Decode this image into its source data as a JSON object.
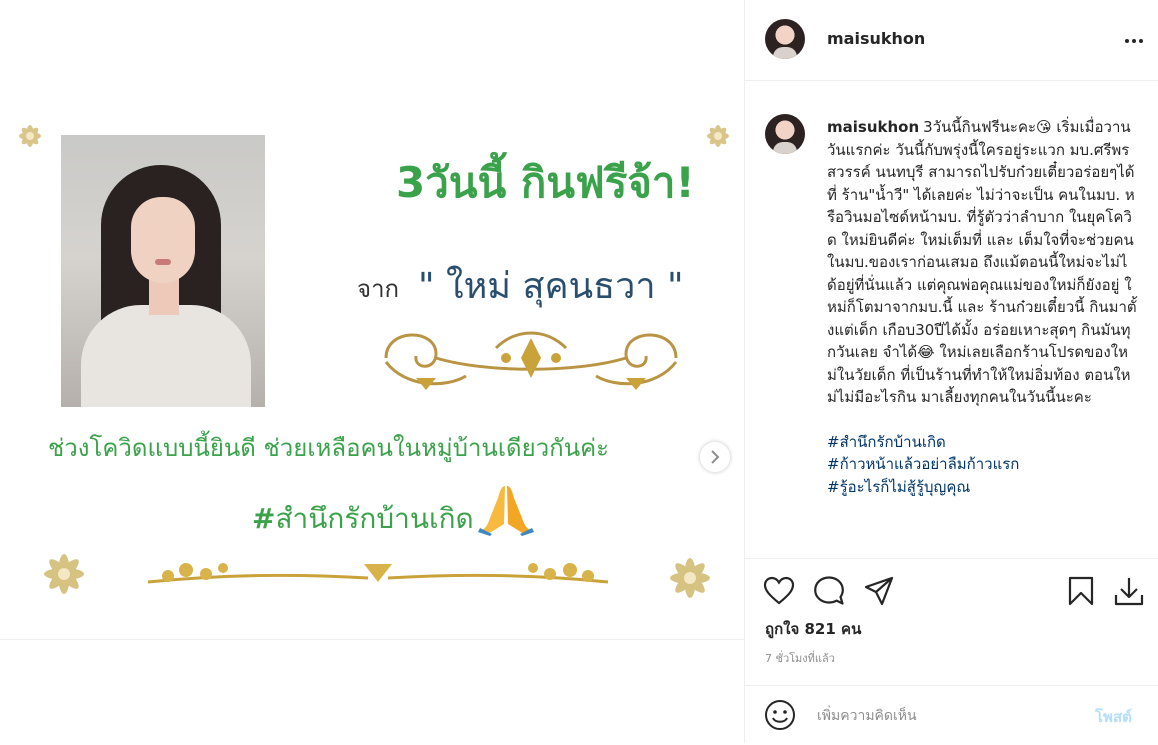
{
  "post": {
    "username": "maisukhon",
    "caption_user": "maisukhon",
    "caption_text": "3วันนี้กินฟรีนะคะ😘 เริ่มเมื่อวานวันแรกค่ะ วันนี้กับพรุ่งนี้ใครอยู่ระแวก มบ.ศรีพรสวรรค์ นนทบุรี สามารถไปรับก๋วยเตี๋ยวอร่อยๆได้ที่ ร้าน\"น้ำวี\" ได้เลยค่ะ ไม่ว่าจะเป็น คนในมบ. หรือวินมอไซด์หน้ามบ. ที่รู้ตัวว่าลำบาก ในยุคโควิด ใหม่ยินดีค่ะ ใหม่เต็มที่ และ เต็มใจที่จะช่วยคนในมบ.ของเราก่อนเสมอ ถึงแม้ตอนนี้ใหม่จะไม่ได้อยู่ที่นั่นแล้ว แต่คุณพ่อคุณแม่ของใหม่ก็ยังอยู่ ใหม่ก็โตมาจากมบ.นี้ และ ร้านก๋วยเตี๋ยวนี้ กินมาตั้งแต่เด็ก เกือบ30ปีได้มั้ง อร่อยเหาะสุดๆ กินมันทุกวันเลย จำได้😂 ใหม่เลยเลือกร้านโปรดของใหม่ในวัยเด็ก ที่เป็นร้านที่ทำให้ใหม่อิ่มท้อง ตอนใหม่ไม่มีอะไรกิน มาเลี้ยงทุกคนในวันนี้นะคะ",
    "hashtags": [
      "#สำนึกรักบ้านเกิด",
      "#ก้าวหน้าแล้วอย่าลืมก้าวแรก",
      "#รู้อะไรก็ไม่สู้รู้บุญคุณ"
    ],
    "likes_text": "ถูกใจ 821 คน",
    "timestamp": "7 ชั่วโมงที่แล้ว"
  },
  "comment": {
    "placeholder": "เพิ่มความคิดเห็น",
    "post_label": "โพสต์"
  },
  "image_text": {
    "headline": "3วันนี้ กินฟรีจ้า!",
    "from_label": "จาก",
    "from_name": "\" ใหม่ สุคนธวา \"",
    "covid_line": "ช่วงโควิดแบบนี้ยินดี  ช่วยเหลือคนในหมู่บ้านเดียวกันค่ะ",
    "hashtag_mark": "#",
    "hashtag_text": "สำนึกรักบ้านเกิด"
  },
  "icons": {
    "more": "more-options-icon",
    "like": "heart-icon",
    "comment": "comment-icon",
    "share": "share-icon",
    "save": "bookmark-icon",
    "download": "download-icon",
    "emoji": "emoji-icon",
    "next": "chevron-right-icon",
    "pray": "praying-hands-icon"
  },
  "colors": {
    "accent_green": "#3aa24a",
    "name_blue": "#2a4f6e",
    "hashtag_link": "#003569",
    "post_button_disabled": "#b2dffc",
    "gold": "#c9a23a"
  }
}
